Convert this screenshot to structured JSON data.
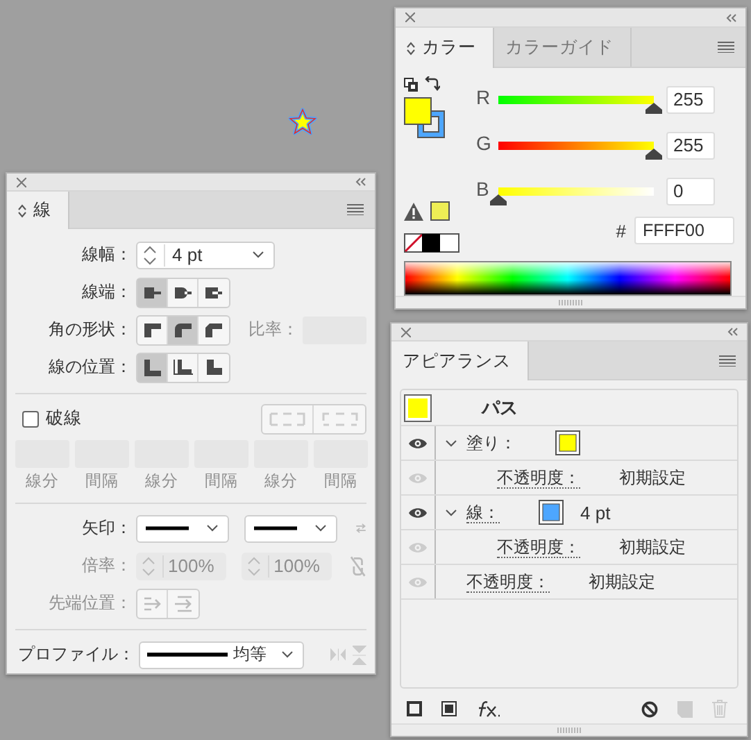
{
  "stroke_panel": {
    "tab": "線",
    "weight": {
      "label": "線幅：",
      "value": "4 pt"
    },
    "cap": {
      "label": "線端：",
      "options": [
        {
          "selected": true
        },
        {
          "selected": false
        },
        {
          "selected": false
        }
      ]
    },
    "join": {
      "label": "角の形状：",
      "options": [
        {
          "selected": false
        },
        {
          "selected": true
        },
        {
          "selected": false
        }
      ],
      "limit": {
        "label": "比率：",
        "disabled": true
      }
    },
    "align": {
      "label": "線の位置：",
      "options": [
        {
          "selected": true
        },
        {
          "selected": false
        },
        {
          "selected": false
        }
      ]
    },
    "dashed": {
      "label": "破線",
      "checked": false
    },
    "dashes": {
      "disabled": true,
      "fields": [
        {
          "label": "線分"
        },
        {
          "label": "間隔"
        },
        {
          "label": "線分"
        },
        {
          "label": "間隔"
        },
        {
          "label": "線分"
        },
        {
          "label": "間隔"
        }
      ]
    },
    "arrowheads": {
      "label": "矢印："
    },
    "scale": {
      "label": "倍率：",
      "values": [
        "100%",
        "100%"
      ],
      "disabled": true
    },
    "tip": {
      "label": "先端位置：",
      "disabled": true
    },
    "profile": {
      "label": "プロファイル：",
      "value": "均等"
    }
  },
  "color_panel": {
    "tabs": [
      {
        "label": "カラー",
        "selected": true
      },
      {
        "label": "カラーガイド",
        "selected": false
      }
    ],
    "channels": [
      {
        "name": "R",
        "level": 1,
        "value": "255"
      },
      {
        "name": "G",
        "level": 1,
        "value": "255"
      },
      {
        "name": "B",
        "level": 0,
        "value": "0"
      }
    ],
    "hex": {
      "label": "#",
      "value": "FFFF00"
    }
  },
  "appearance_panel": {
    "tab": "アピアランス",
    "object": "パス",
    "rows": [
      {
        "kind": "fill",
        "label": "塗り：",
        "color": "#ffff00",
        "visible": true,
        "expanded": true,
        "children": [
          {
            "kind": "opacity",
            "label": "不透明度：",
            "value": "初期設定",
            "visible": false
          }
        ]
      },
      {
        "kind": "stroke",
        "label": "線：",
        "color": "#4da6ff",
        "value": "4 pt",
        "visible": true,
        "expanded": true,
        "children": [
          {
            "kind": "opacity",
            "label": "不透明度：",
            "value": "初期設定",
            "visible": false
          }
        ]
      },
      {
        "kind": "opacity",
        "label": "不透明度：",
        "value": "初期設定",
        "visible": false
      }
    ]
  }
}
